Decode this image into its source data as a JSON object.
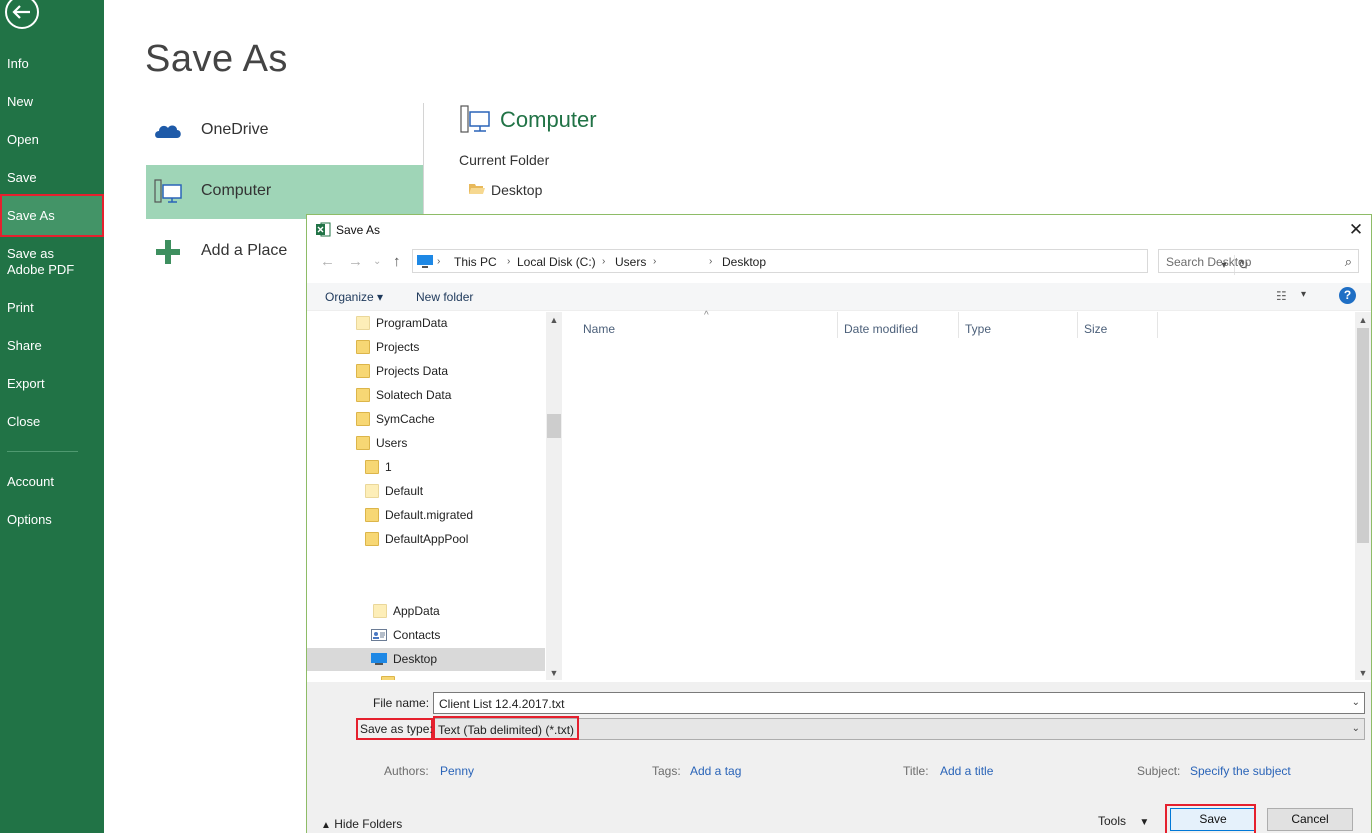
{
  "backstage": {
    "nav": [
      "Info",
      "New",
      "Open",
      "Save",
      "Save As",
      "Save as Adobe PDF",
      "Print",
      "Share",
      "Export",
      "Close",
      "Account",
      "Options"
    ],
    "selected_nav": "Save As",
    "title": "Save As",
    "places": [
      "OneDrive",
      "Computer",
      "Add a Place"
    ],
    "selected_place": "Computer",
    "computer_heading": "Computer",
    "current_folder_label": "Current Folder",
    "current_folder": "Desktop"
  },
  "dialog": {
    "title": "Save As",
    "close": "✕",
    "breadcrumb": [
      "This PC",
      "Local Disk (C:)",
      "Users",
      "Desktop"
    ],
    "search_placeholder": "Search Desktop",
    "toolbar": {
      "organize": "Organize ▾",
      "new_folder": "New folder",
      "help": "?"
    },
    "tree": [
      {
        "label": "ProgramData"
      },
      {
        "label": "Projects"
      },
      {
        "label": "Projects Data"
      },
      {
        "label": "Solatech Data"
      },
      {
        "label": "SymCache"
      },
      {
        "label": "Users"
      },
      {
        "label": "1"
      },
      {
        "label": "Default"
      },
      {
        "label": "Default.migrated"
      },
      {
        "label": "DefaultAppPool"
      },
      {
        "label": "AppData"
      },
      {
        "label": "Contacts"
      },
      {
        "label": "Desktop"
      }
    ],
    "selected_tree": "Desktop",
    "columns": [
      "Name",
      "Date modified",
      "Type",
      "Size"
    ],
    "file_name_label": "File name:",
    "file_name": "Client List 12.4.2017.txt",
    "save_type_label": "Save as type:",
    "save_type": "Text (Tab delimited) (*.txt)",
    "authors_label": "Authors:",
    "authors": "Penny",
    "tags_label": "Tags:",
    "tags": "Add a tag",
    "title_label": "Title:",
    "title_value": "Add a title",
    "subject_label": "Subject:",
    "subject": "Specify the subject",
    "hide_folders": "Hide Folders",
    "tools": "Tools",
    "save_button": "Save",
    "cancel_button": "Cancel"
  },
  "colors": {
    "excel_green": "#217346",
    "selected_place": "#9fd5b7",
    "highlight_red": "#e5202e",
    "link_blue": "#2a64b8"
  }
}
